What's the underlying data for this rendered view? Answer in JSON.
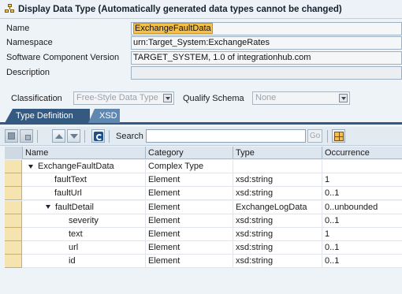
{
  "window": {
    "title": "Display Data Type (Automatically generated data types cannot be changed)"
  },
  "fields": [
    {
      "label": "Name",
      "value": "ExchangeFaultData",
      "highlight": true
    },
    {
      "label": "Namespace",
      "value": "urn:Target_System:ExchangeRates",
      "highlight": false
    },
    {
      "label": "Software Component Version",
      "value": "TARGET_SYSTEM, 1.0 of integrationhub.com",
      "highlight": false
    },
    {
      "label": "Description",
      "value": "",
      "highlight": false
    }
  ],
  "classification": {
    "label": "Classification",
    "value": "Free-Style Data Type"
  },
  "qualify_schema": {
    "label": "Qualify Schema",
    "value": "None"
  },
  "tabs": [
    {
      "label": "Type Definition",
      "active": true
    },
    {
      "label": "XSD",
      "active": false
    }
  ],
  "toolbar": {
    "search_label": "Search",
    "search_value": "",
    "go_label": "Go"
  },
  "table": {
    "columns": [
      "Name",
      "Category",
      "Type",
      "Occurrence"
    ],
    "rows": [
      {
        "name": "ExchangeFaultData",
        "indent": 0,
        "toggle": true,
        "category": "Complex Type",
        "type": "",
        "occurrence": ""
      },
      {
        "name": "faultText",
        "indent": 1,
        "toggle": false,
        "category": "Element",
        "type": "xsd:string",
        "occurrence": "1"
      },
      {
        "name": "faultUrl",
        "indent": 1,
        "toggle": false,
        "category": "Element",
        "type": "xsd:string",
        "occurrence": "0..1"
      },
      {
        "name": "faultDetail",
        "indent": 1,
        "toggle": true,
        "category": "Element",
        "type": "ExchangeLogData",
        "occurrence": "0..unbounded"
      },
      {
        "name": "severity",
        "indent": 2,
        "toggle": false,
        "category": "Element",
        "type": "xsd:string",
        "occurrence": "0..1"
      },
      {
        "name": "text",
        "indent": 2,
        "toggle": false,
        "category": "Element",
        "type": "xsd:string",
        "occurrence": "1"
      },
      {
        "name": "url",
        "indent": 2,
        "toggle": false,
        "category": "Element",
        "type": "xsd:string",
        "occurrence": "0..1"
      },
      {
        "name": "id",
        "indent": 2,
        "toggle": false,
        "category": "Element",
        "type": "xsd:string",
        "occurrence": "0..1"
      }
    ]
  },
  "colors": {
    "tab_active": "#355a82",
    "tab_inactive": "#5f87b0",
    "highlight": "#f5c04a",
    "row_selector": "#f5e3b0"
  }
}
